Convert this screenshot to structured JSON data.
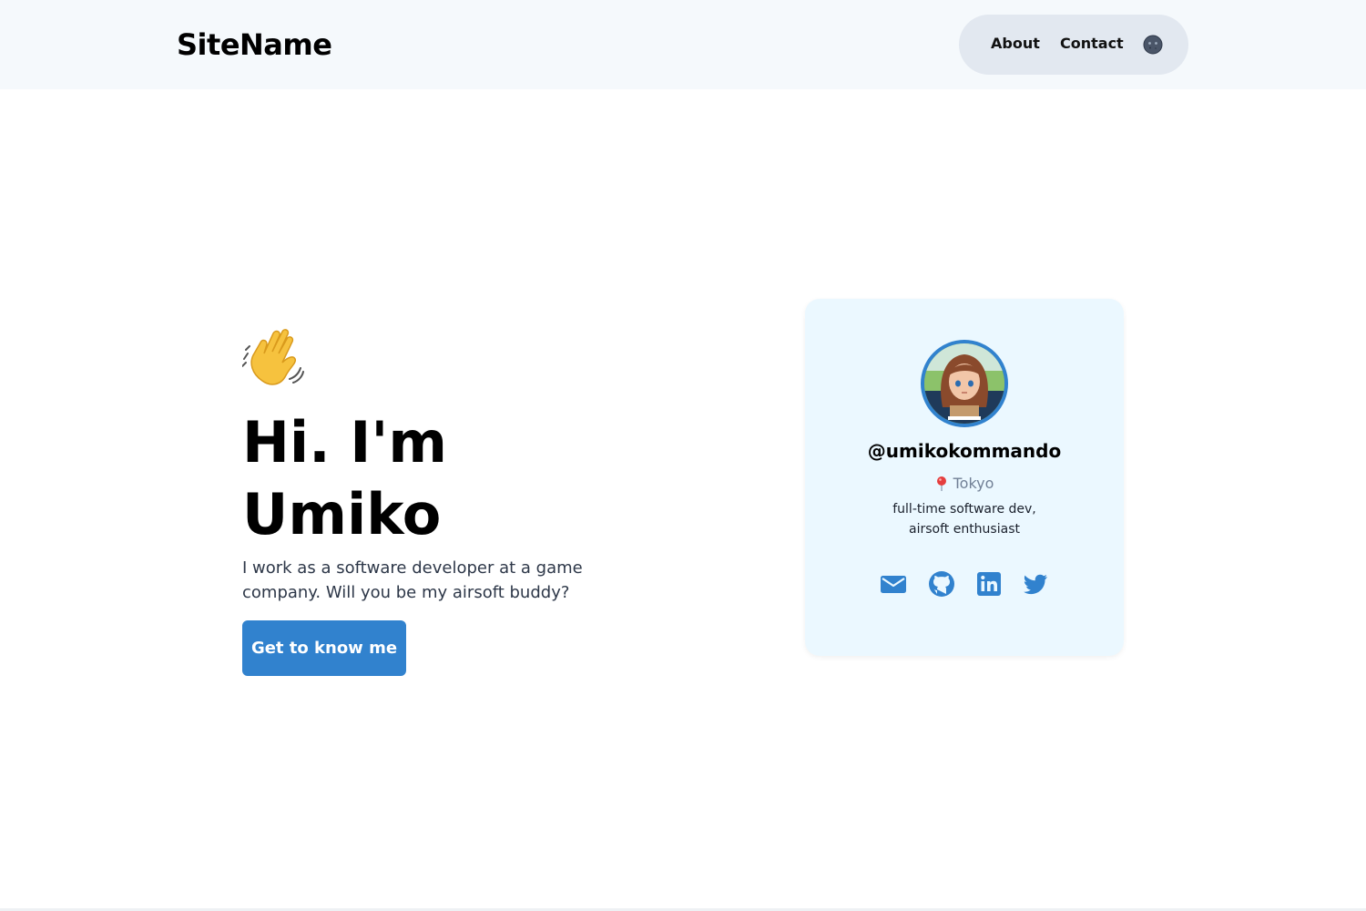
{
  "header": {
    "logo": "SiteName",
    "nav": [
      {
        "label": "About"
      },
      {
        "label": "Contact"
      }
    ],
    "theme_toggle_icon": "moon-face-icon"
  },
  "hero": {
    "wave_icon": "waving-hand-icon",
    "greeting_line1": "Hi. I'm",
    "greeting_line2": "Umiko",
    "intro": "I work as a software developer at a game company. Will you be my airsoft buddy?",
    "cta_label": "Get to know me"
  },
  "profile_card": {
    "avatar_icon": "anime-avatar",
    "handle": "@umikokommando",
    "location_icon": "round-pushpin-icon",
    "location": "Tokyo",
    "bio_line1": "full-time software dev,",
    "bio_line2": "airsoft enthusiast",
    "socials": [
      {
        "icon": "mail-icon"
      },
      {
        "icon": "github-icon"
      },
      {
        "icon": "linkedin-icon"
      },
      {
        "icon": "twitter-icon"
      }
    ]
  },
  "colors": {
    "accent": "#3182ce",
    "header_bg": "#f5f9fc",
    "nav_bg": "#e2e8f0",
    "card_bg": "#ebf8ff"
  }
}
